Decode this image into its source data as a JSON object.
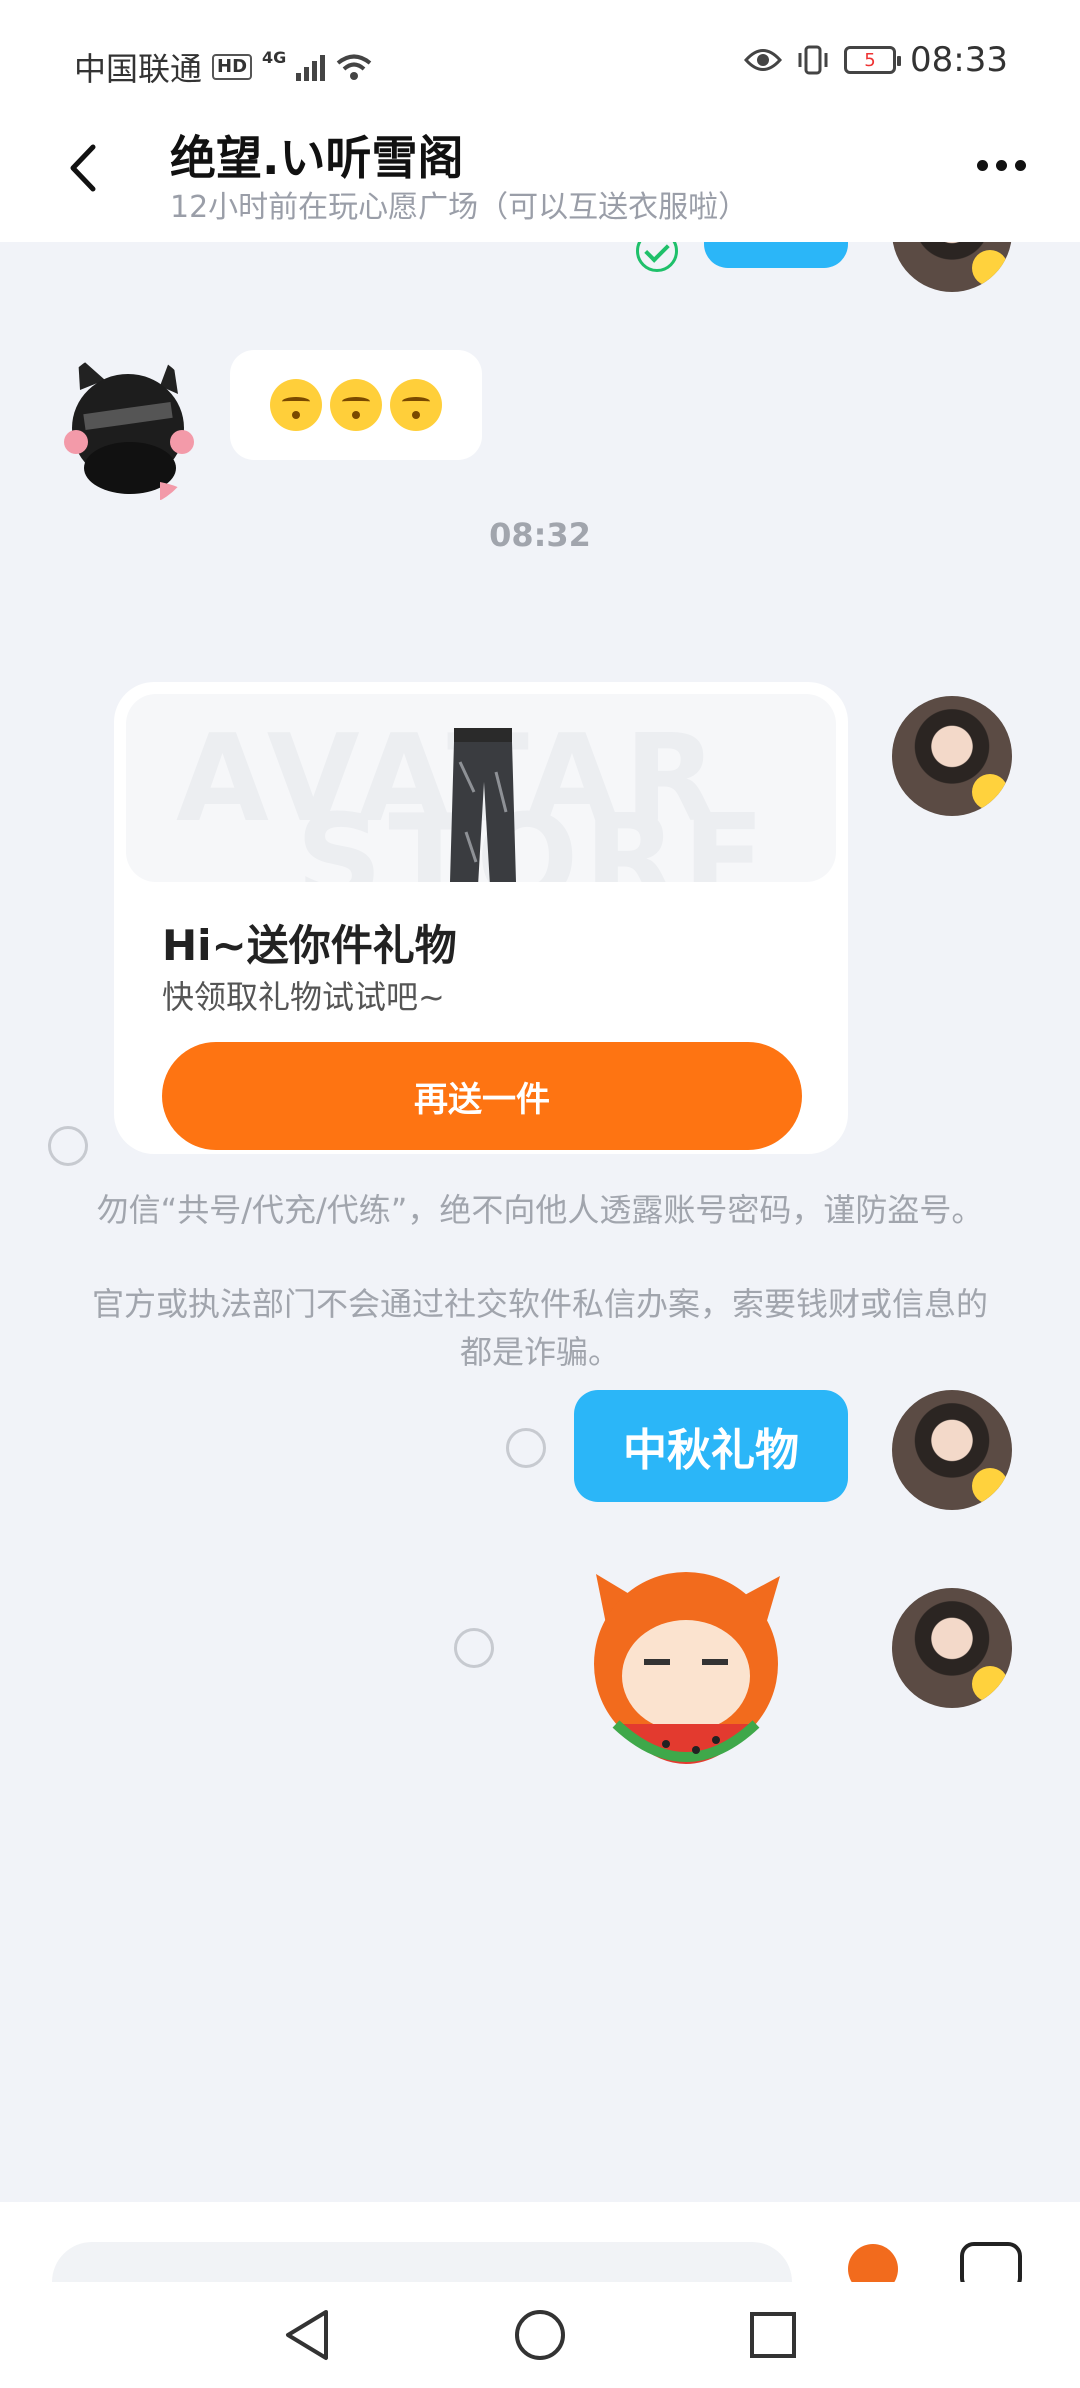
{
  "status_bar": {
    "carrier": "中国联通",
    "hd": "HD",
    "network": "4G",
    "battery": "5",
    "time": "08:33"
  },
  "header": {
    "title": "绝望.い听雪阁",
    "subtitle": "12小时前在玩心愿广场（可以互送衣服啦）"
  },
  "chat": {
    "time_divider": "08:32",
    "gift_card": {
      "watermark_line1": "AVATAR",
      "watermark_line2": "STORE",
      "title": "Hi~送你件礼物",
      "description": "快领取礼物试试吧~",
      "button_label": "再送一件"
    },
    "notice_1": "勿信“共号/代充/代练”，绝不向他人透露账号密码，谨防盗号。",
    "notice_2": "官方或执法部门不会通过社交软件私信办案，索要钱财或信息的都是诈骗。",
    "sent_message": "中秋礼物"
  },
  "colors": {
    "accent_blue": "#2bb6f8",
    "accent_orange": "#fe7412",
    "background": "#f1f3f8"
  }
}
